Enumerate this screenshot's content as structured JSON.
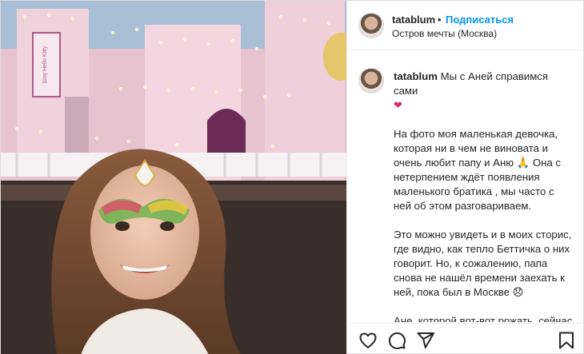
{
  "post": {
    "username": "tatablum",
    "separator": "•",
    "follow_label": "Подписаться",
    "location": "Остров мечты (Москва)"
  },
  "photo": {
    "sign_text": "Шоу Hello Kitty",
    "alt": "photo"
  },
  "caption": {
    "username": "tatablum",
    "first_line": "Мы с Аней справимся сами",
    "heart": "❤",
    "paragraphs": [
      "На фото моя маленькая девочка, которая ни в чем не виновата и очень любит папу и Аню 🙏 Она с нетерпением ждёт появления маленького братика , мы часто с ней об этом разговариваем.",
      "Это можно увидеть и в моих сторис, где видно, как тепло Беттичка о них говорит. Но, к сожалению, папа снова не нашёл времени заехать к ней, пока был в Москве 😞",
      "Ане, которой вот-вот рожать, сейчас особенно несладко, ведь они с Валерой разошлись. Мы списались с ней и договорились, что"
    ]
  },
  "actions": {
    "like_icon": "heart-outline-icon",
    "comment_icon": "comment-icon",
    "share_icon": "paper-plane-icon",
    "save_icon": "bookmark-icon"
  }
}
